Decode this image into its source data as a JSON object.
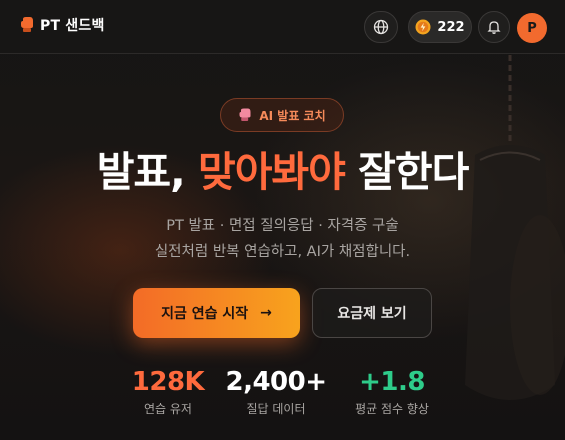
{
  "header": {
    "logo_text": "PT 샌드백",
    "logo_icon": "boxing-glove-icon",
    "coins": "222",
    "avatar_initial": "P"
  },
  "badge": {
    "text": "AI 발표 코치",
    "icon": "boxing-glove-icon"
  },
  "headline": {
    "part1": "발표, ",
    "accent": "맞아봐야",
    "part2": " 잘한다"
  },
  "subtitle": {
    "line1": "PT 발표 · 면접 질의응답 · 자격증 구술",
    "line2": "실전처럼 반복 연습하고, AI가 채점합니다."
  },
  "buttons": {
    "primary": "지금 연습 시작",
    "primary_arrow": "→",
    "secondary": "요금제 보기"
  },
  "stats": [
    {
      "value": "128K",
      "label": "연습 유저",
      "color": "#ff6a3d"
    },
    {
      "value": "2,400+",
      "label": "질답 데이터",
      "color": "#ffffff"
    },
    {
      "value": "+1.8",
      "label": "평균 점수 향상",
      "color": "#2ecc8a"
    }
  ],
  "colors": {
    "accent": "#ff6a3d",
    "cta_start": "#f36b27",
    "cta_end": "#f8a31d",
    "positive": "#2ecc8a"
  }
}
